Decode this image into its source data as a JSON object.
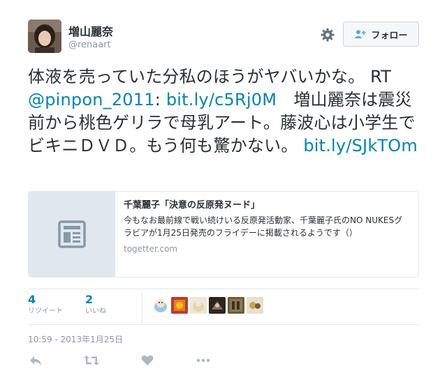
{
  "user": {
    "display_name": "増山麗奈",
    "handle": "@renaart"
  },
  "follow_button": {
    "label": "フォロー"
  },
  "tweet": {
    "part1": "体液を売っていた分私のほうがヤバいかな。 RT ",
    "mention": "@pinpon_2011",
    "part2": ": ",
    "link1": "bit.ly/c5Rj0M",
    "part3": "　増山麗奈は震災前から桃色ゲリラで母乳アート。藤波心は小学生でビキニＤＶＤ。もう何も驚かない。 ",
    "link2": "bit.ly/SJkTOm"
  },
  "card": {
    "title": "千葉麗子「決意の反原発ヌード」",
    "description": "今もなお最前線で戦い続けいる反原発活動家、千葉麗子氏のNO NUKESグラビアが1月25日発売のフライデーに掲載されるようです（）",
    "domain": "togetter.com"
  },
  "stats": {
    "retweets_count": "4",
    "retweets_label": "リツイート",
    "likes_count": "2",
    "likes_label": "いいね"
  },
  "timestamp": "10:59 - 2013年1月25日",
  "icons": {
    "gear": "gear-icon",
    "follow": "follow-user-icon",
    "card_thumb": "document-icon",
    "reply": "reply-icon",
    "retweet": "retweet-icon",
    "like": "heart-icon",
    "more": "more-icon"
  },
  "colors": {
    "link": "#0084b4",
    "text": "#292f33",
    "muted": "#8899a6",
    "border": "#e1e8ed"
  }
}
